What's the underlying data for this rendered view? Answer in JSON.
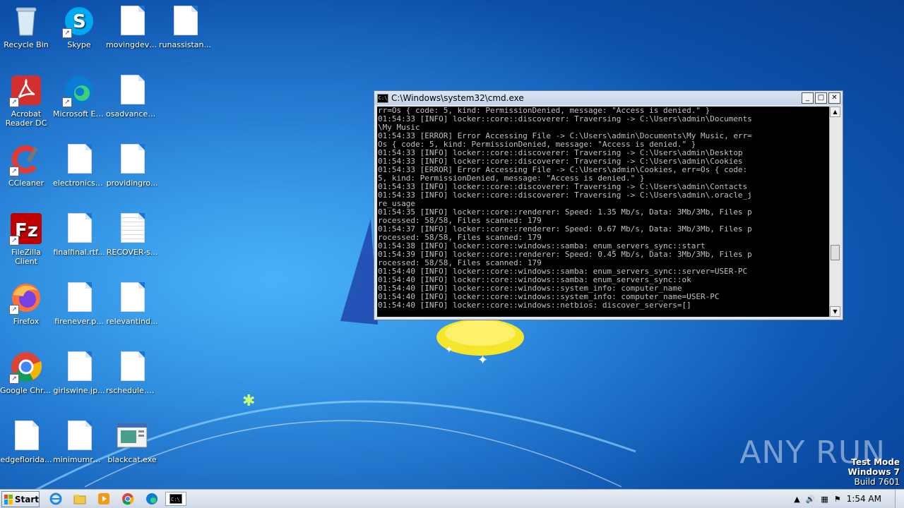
{
  "desktop": {
    "icons": [
      {
        "label": "Recycle Bin",
        "icon": "recycle-bin-icon"
      },
      {
        "label": "Skype",
        "icon": "skype-icon"
      },
      {
        "label": "movingdeve...",
        "icon": "file-icon"
      },
      {
        "label": "runassistan...",
        "icon": "file-icon"
      },
      {
        "label": "Acrobat Reader DC",
        "icon": "acrobat-icon"
      },
      {
        "label": "Microsoft Edge",
        "icon": "edge-icon"
      },
      {
        "label": "osadvanced...",
        "icon": "file-icon"
      },
      {
        "label": "CCleaner",
        "icon": "ccleaner-icon"
      },
      {
        "label": "electronicsp...",
        "icon": "file-icon"
      },
      {
        "label": "providingro...",
        "icon": "file-icon"
      },
      {
        "label": "FileZilla Client",
        "icon": "filezilla-icon"
      },
      {
        "label": "finalfinal.rtf...",
        "icon": "file-icon"
      },
      {
        "label": "RECOVER-s...",
        "icon": "text-file-icon"
      },
      {
        "label": "Firefox",
        "icon": "firefox-icon"
      },
      {
        "label": "firenever.p...",
        "icon": "file-icon"
      },
      {
        "label": "relevantind...",
        "icon": "file-icon"
      },
      {
        "label": "Google Chrome",
        "icon": "chrome-icon"
      },
      {
        "label": "girlswine.jp...",
        "icon": "file-icon"
      },
      {
        "label": "rschedule.p...",
        "icon": "file-icon"
      },
      {
        "label": "edgeflorida...",
        "icon": "file-icon"
      },
      {
        "label": "minimumrest...",
        "icon": "file-icon"
      },
      {
        "label": "blackcat.exe",
        "icon": "exe-icon"
      }
    ]
  },
  "cmd": {
    "title": "C:\\Windows\\system32\\cmd.exe",
    "lines": [
      "rr=Os { code: 5, kind: PermissionDenied, message: \"Access is denied.\" }",
      "01:54:33 [INFO] locker::core::discoverer: Traversing -> C:\\Users\\admin\\Documents",
      "\\My Music",
      "01:54:33 [ERROR] Error Accessing File -> C:\\Users\\admin\\Documents\\My Music, err=",
      "Os { code: 5, kind: PermissionDenied, message: \"Access is denied.\" }",
      "01:54:33 [INFO] locker::core::discoverer: Traversing -> C:\\Users\\admin\\Desktop",
      "01:54:33 [INFO] locker::core::discoverer: Traversing -> C:\\Users\\admin\\Cookies",
      "01:54:33 [ERROR] Error Accessing File -> C:\\Users\\admin\\Cookies, err=Os { code:",
      "5, kind: PermissionDenied, message: \"Access is denied.\" }",
      "01:54:33 [INFO] locker::core::discoverer: Traversing -> C:\\Users\\admin\\Contacts",
      "01:54:33 [INFO] locker::core::discoverer: Traversing -> C:\\Users\\admin\\.oracle_j",
      "re_usage",
      "01:54:35 [INFO] locker::core::renderer: Speed: 1.35 Mb/s, Data: 3Mb/3Mb, Files p",
      "rocessed: 58/58, Files scanned: 179",
      "01:54:37 [INFO] locker::core::renderer: Speed: 0.67 Mb/s, Data: 3Mb/3Mb, Files p",
      "rocessed: 58/58, Files scanned: 179",
      "01:54:38 [INFO] locker::core::windows::samba: enum_servers_sync::start",
      "01:54:39 [INFO] locker::core::renderer: Speed: 0.45 Mb/s, Data: 3Mb/3Mb, Files p",
      "rocessed: 58/58, Files scanned: 179",
      "01:54:40 [INFO] locker::core::windows::samba: enum_servers_sync::server=USER-PC",
      "01:54:40 [INFO] locker::core::windows::samba: enum_servers_sync::ok",
      "01:54:40 [INFO] locker::core::windows::system_info: computer_name",
      "01:54:40 [INFO] locker::core::windows::system_info: computer_name=USER-PC",
      "01:54:40 [INFO] locker::core::windows::netbios: discover_servers=[]"
    ]
  },
  "taskbar": {
    "start_label": "Start",
    "pinned": [
      "ie-icon",
      "explorer-icon",
      "media-player-icon",
      "chrome-icon",
      "edge-icon",
      "cmd-icon"
    ],
    "clock": "1:54 AM"
  },
  "watermark": "ANY RUN",
  "test_mode": {
    "line1": "Test Mode",
    "line2": "Windows 7",
    "line3": "Build 7601"
  }
}
